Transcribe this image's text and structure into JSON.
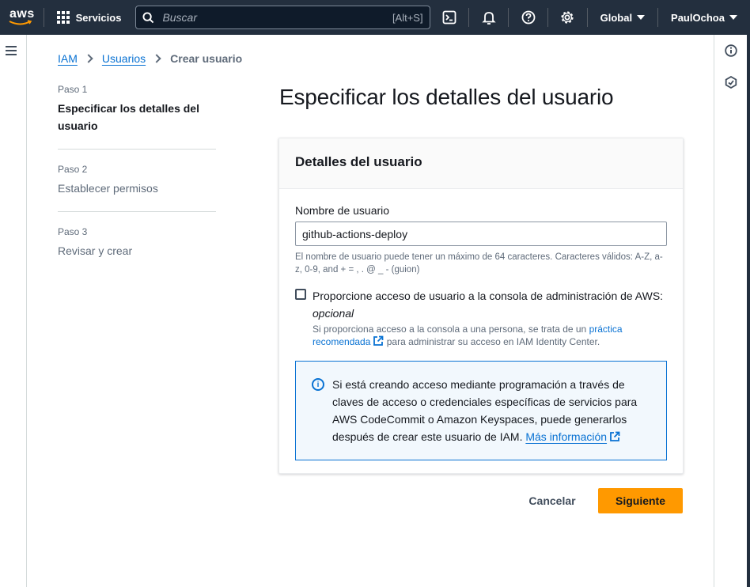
{
  "topbar": {
    "logo": "aws",
    "services_label": "Servicios",
    "search_placeholder": "Buscar",
    "search_shortcut": "[Alt+S]",
    "region_label": "Global",
    "user_label": "PaulOchoa"
  },
  "breadcrumb": {
    "items": [
      "IAM",
      "Usuarios"
    ],
    "current": "Crear usuario"
  },
  "steps": [
    {
      "num": "Paso 1",
      "label": "Especificar los detalles del usuario",
      "active": true
    },
    {
      "num": "Paso 2",
      "label": "Establecer permisos",
      "active": false
    },
    {
      "num": "Paso 3",
      "label": "Revisar y crear",
      "active": false
    }
  ],
  "page_title": "Especificar los detalles del usuario",
  "card": {
    "title": "Detalles del usuario",
    "username_label": "Nombre de usuario",
    "username_value": "github-actions-deploy",
    "username_hint": "El nombre de usuario puede tener un máximo de 64 caracteres. Caracteres válidos: A-Z, a-z, 0-9, and + = , . @ _ - (guion)",
    "console_access": {
      "checked": false,
      "label": "Proporcione acceso de usuario a la consola de administración de AWS:",
      "optional": "opcional",
      "desc_before": "Si proporciona acceso a la consola a una persona, se trata de un ",
      "desc_link": "práctica recomendada",
      "desc_after": " para administrar su acceso en IAM Identity Center."
    },
    "info": {
      "text": "Si está creando acceso mediante programación a través de claves de acceso o credenciales específicas de servicios para AWS CodeCommit o Amazon Keyspaces, puede generarlos después de crear este usuario de IAM. ",
      "link": "Más información"
    }
  },
  "actions": {
    "cancel": "Cancelar",
    "next": "Siguiente"
  },
  "colors": {
    "nav_bg": "#232f3e",
    "link": "#0972d3",
    "primary_button": "#ff9900"
  }
}
